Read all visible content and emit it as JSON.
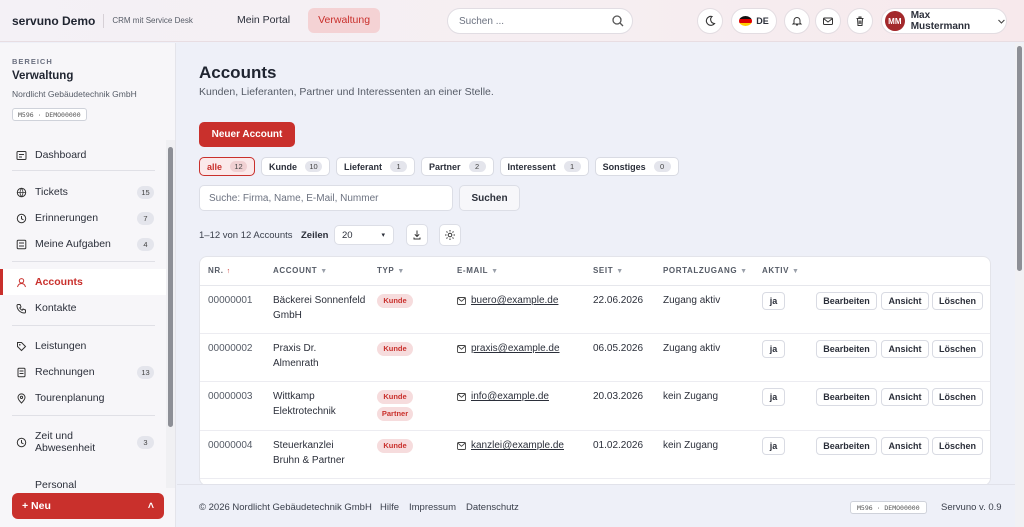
{
  "topbar": {
    "brand": "servuno Demo",
    "brand_sub": "CRM mit Service Desk",
    "tabs": [
      {
        "label": "Mein Portal"
      },
      {
        "label": "Verwaltung"
      }
    ],
    "search_placeholder": "Suchen ...",
    "language": "DE",
    "user_initials": "MM",
    "user_name": "Max Mustermann"
  },
  "sidebar": {
    "caption": "BEREICH",
    "title": "Verwaltung",
    "org": "Nordlicht Gebäudetechnik GmbH",
    "tenant": "M596 · DEMO00000",
    "items": [
      {
        "label": "Dashboard",
        "icon": "dashboard-icon"
      },
      {
        "label": "Tickets",
        "count": "15",
        "icon": "globe-icon"
      },
      {
        "label": "Erinnerungen",
        "count": "7",
        "icon": "clock-icon"
      },
      {
        "label": "Meine Aufgaben",
        "count": "4",
        "icon": "tasks-icon"
      },
      {
        "label": "Accounts",
        "icon": "user-icon"
      },
      {
        "label": "Kontakte",
        "icon": "phone-icon"
      },
      {
        "label": "Leistungen",
        "icon": "tag-icon"
      },
      {
        "label": "Rechnungen",
        "count": "13",
        "icon": "invoice-icon"
      },
      {
        "label": "Tourenplanung",
        "icon": "pin-icon"
      },
      {
        "label": "Zeit und Abwesenheit",
        "count": "3",
        "icon": "clock-icon"
      },
      {
        "label": "Personal"
      }
    ],
    "new_button": "+ Neu",
    "new_caret": "˄"
  },
  "main": {
    "title": "Accounts",
    "subtitle": "Kunden, Lieferanten, Partner und Interessenten an einer Stelle.",
    "new_account": "Neuer Account",
    "filters": [
      {
        "label": "alle",
        "count": "12"
      },
      {
        "label": "Kunde",
        "count": "10"
      },
      {
        "label": "Lieferant",
        "count": "1"
      },
      {
        "label": "Partner",
        "count": "2"
      },
      {
        "label": "Interessent",
        "count": "1"
      },
      {
        "label": "Sonstiges",
        "count": "0"
      }
    ],
    "search_placeholder": "Suche: Firma, Name, E-Mail, Nummer",
    "search_button": "Suchen",
    "paging": "1–12 von 12 Accounts",
    "rows_label": "Zeilen",
    "rows_value": "20",
    "columns": [
      "NR.",
      "ACCOUNT",
      "TYP",
      "E-MAIL",
      "SEIT",
      "PORTALZUGANG",
      "AKTIV"
    ],
    "rows": [
      {
        "nr": "00000001",
        "account": "Bäckerei Sonnenfeld GmbH",
        "types": [
          "Kunde"
        ],
        "email": "buero@example.de",
        "since": "22.06.2026",
        "portal": "Zugang aktiv",
        "active": "ja"
      },
      {
        "nr": "00000002",
        "account": "Praxis Dr. Almenrath",
        "types": [
          "Kunde"
        ],
        "email": "praxis@example.de",
        "since": "06.05.2026",
        "portal": "Zugang aktiv",
        "active": "ja"
      },
      {
        "nr": "00000003",
        "account": "Wittkamp Elektrotechnik",
        "types": [
          "Kunde",
          "Partner"
        ],
        "email": "info@example.de",
        "since": "20.03.2026",
        "portal": "kein Zugang",
        "active": "ja"
      },
      {
        "nr": "00000004",
        "account": "Steuerkanzlei Bruhn & Partner",
        "types": [
          "Kunde"
        ],
        "email": "kanzlei@example.de",
        "since": "01.02.2026",
        "portal": "kein Zugang",
        "active": "ja"
      }
    ],
    "actions": {
      "edit": "Bearbeiten",
      "view": "Ansicht",
      "delete": "Löschen"
    }
  },
  "footer": {
    "copyright": "© 2026 Nordlicht Gebäudetechnik GmbH",
    "links": [
      "Hilfe",
      "Impressum",
      "Datenschutz"
    ],
    "tenant": "M596 · DEMO00000",
    "version": "Servuno v. 0.9"
  },
  "colors": {
    "accent": "#c9302c",
    "badge_bg": "#f6dcdd",
    "background": "#eef0f8"
  }
}
